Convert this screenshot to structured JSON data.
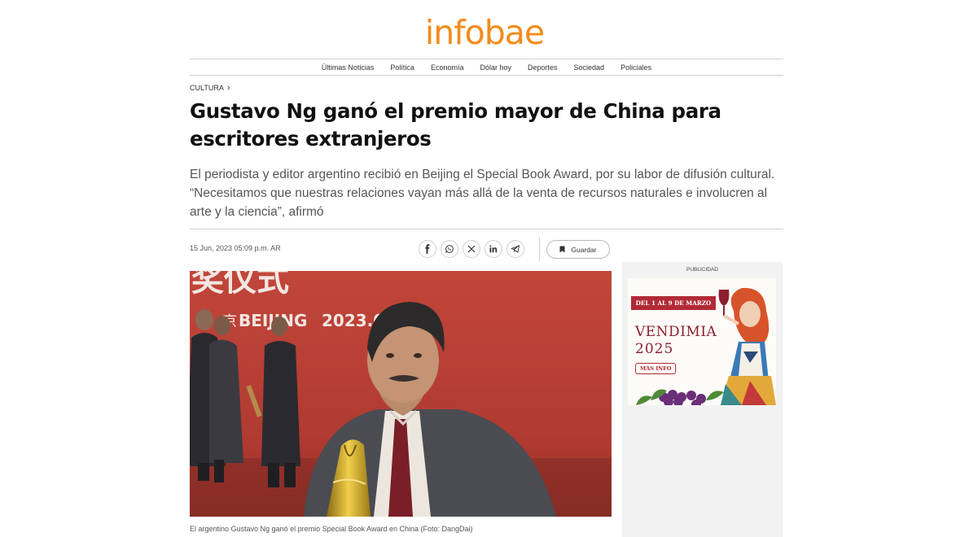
{
  "brand": {
    "logo": "infobae",
    "color": "#f28c1b"
  },
  "nav": {
    "items": [
      {
        "label": "Últimas Noticias"
      },
      {
        "label": "Política"
      },
      {
        "label": "Economía"
      },
      {
        "label": "Dólar hoy"
      },
      {
        "label": "Deportes"
      },
      {
        "label": "Sociedad"
      },
      {
        "label": "Policiales"
      }
    ]
  },
  "article": {
    "section": "CULTURA",
    "title": "Gustavo Ng ganó el premio mayor de China para escritores extranjeros",
    "subtitle": "El periodista y editor argentino recibió en Beijing el Special Book Award, por su labor de difusión cultural. “Necesitamos que nuestras relaciones vayan más allá de la venta de recursos naturales e involucren al arte y la ciencia”, afirmó",
    "timestamp": "15 Jun, 2023 05:09 p.m. AR",
    "share_icons": [
      "facebook-icon",
      "whatsapp-icon",
      "x-icon",
      "linkedin-icon",
      "telegram-icon"
    ],
    "save_label": "Guardar",
    "photo": {
      "backdrop_text": "BEIJING",
      "backdrop_year": "2023.0",
      "backdrop_chars": "奖仪式",
      "backdrop_char_short": "京",
      "caption": "El argentino Gustavo Ng ganó el premio Special Book Award en China (Foto: DangDai)"
    }
  },
  "sidebar": {
    "ad_label": "PUBLICIDAD",
    "ad": {
      "dates": "DEL 1 AL 9 DE MARZO",
      "title_line1": "VENDIMIA",
      "title_line2": "2025",
      "cta": "MÁS INFO"
    }
  }
}
